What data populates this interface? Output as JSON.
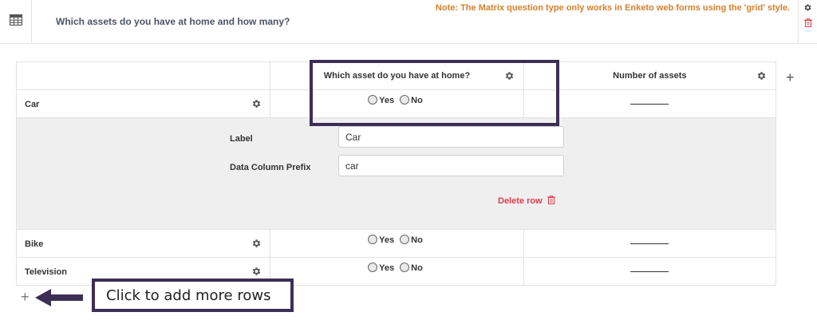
{
  "question": {
    "type_icon": "table-icon",
    "title": "Which assets do you have at home and how many?",
    "note": "Note: The Matrix question type only works in Enketo web forms using the 'grid' style."
  },
  "matrix": {
    "columns": [
      {
        "label": "Which asset do you have at home?"
      },
      {
        "label": "Number of assets"
      }
    ],
    "rows": [
      {
        "label": "Car"
      },
      {
        "label": "Bike"
      },
      {
        "label": "Television"
      }
    ],
    "radio_options": [
      "Yes",
      "No"
    ],
    "editor": {
      "label_field_label": "Label",
      "label_field_value": "Car",
      "prefix_field_label": "Data Column Prefix",
      "prefix_field_value": "car",
      "delete_label": "Delete row"
    }
  },
  "annotation": {
    "callout_text": "Click to add more rows",
    "highlight_color": "#3c2f55"
  },
  "colors": {
    "note": "#d77f28",
    "delete": "#e03b4a",
    "editor_bg": "#efefef"
  }
}
